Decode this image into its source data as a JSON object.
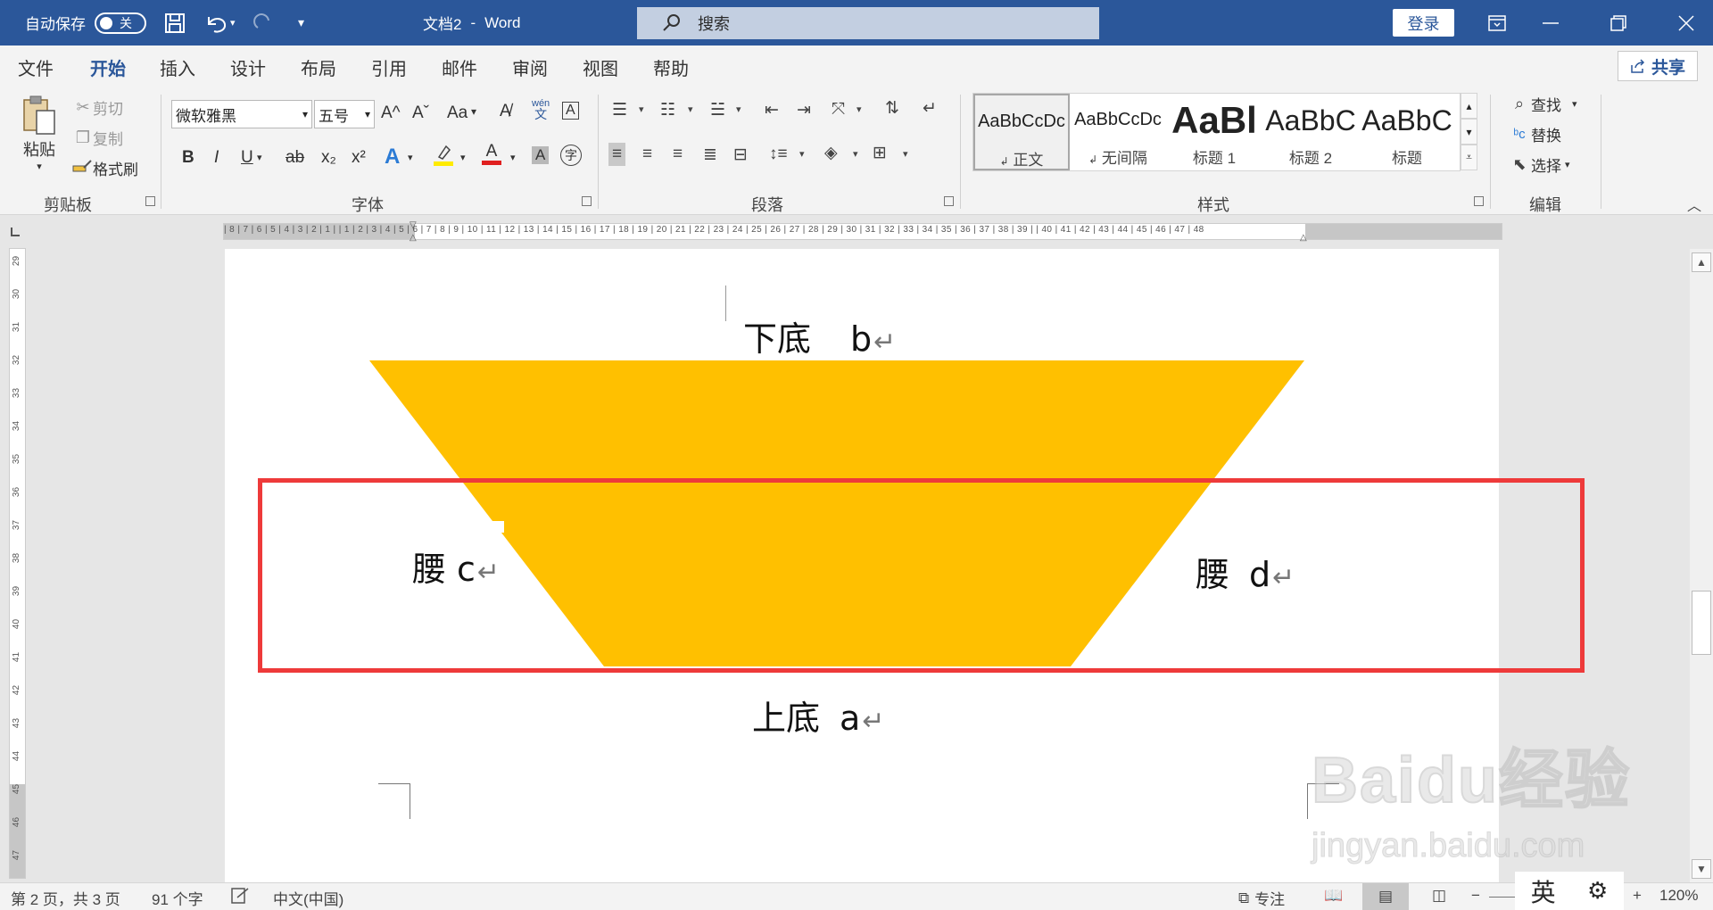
{
  "titlebar": {
    "autosave_label": "自动保存",
    "autosave_state": "关",
    "doc_title": "文档2",
    "separator": "-",
    "app_name": "Word",
    "search_placeholder": "搜索",
    "login_label": "登录"
  },
  "tabs": {
    "items": [
      "文件",
      "开始",
      "插入",
      "设计",
      "布局",
      "引用",
      "邮件",
      "审阅",
      "视图",
      "帮助"
    ],
    "active": "开始",
    "share_label": "共享"
  },
  "ribbon": {
    "clipboard": {
      "group_label": "剪贴板",
      "paste": "粘贴",
      "cut": "剪切",
      "copy": "复制",
      "format_painter": "格式刷"
    },
    "font": {
      "group_label": "字体",
      "font_name": "微软雅黑",
      "font_size": "五号",
      "grow": "A^",
      "shrink": "Aˇ",
      "change_case": "Aa",
      "phonetic_top": "wén",
      "phonetic_bottom": "文",
      "bold": "B",
      "italic": "I",
      "underline": "U",
      "strike": "ab",
      "subscript": "x₂",
      "superscript": "x²",
      "font_color_letter": "A",
      "shade_letter": "A",
      "enclose": "字",
      "colors": {
        "highlight": "#ffeb00",
        "font_color": "#e02020",
        "text_effect": "#2b7bd5"
      }
    },
    "paragraph": {
      "group_label": "段落"
    },
    "styles": {
      "group_label": "样式",
      "items": [
        {
          "preview": "AaBbCcDc",
          "name": "正文",
          "mark": "↲"
        },
        {
          "preview": "AaBbCcDc",
          "name": "无间隔",
          "mark": "↲"
        },
        {
          "preview": "AaBl",
          "name": "标题 1"
        },
        {
          "preview": "AaBbC",
          "name": "标题 2"
        },
        {
          "preview": "AaBbC",
          "name": "标题"
        }
      ]
    },
    "editing": {
      "group_label": "编辑",
      "find": "查找",
      "replace": "替换",
      "select": "选择"
    }
  },
  "ruler": {
    "horizontal_labels": "| 8 | 7 | 6 | 5 | 4 | 3 | 2 | 1 |  | 1 | 2 | 3 | 4 | 5 | 6 | 7 | 8 | 9 | 10 | 11 | 12 | 13 | 14 | 15 | 16 | 17 | 18 | 19 | 20 | 21 | 22 | 23 | 24 | 25 | 26 | 27 | 28 | 29 | 30 | 31 | 32 | 33 | 34 | 35 | 36 | 37 | 38 | 39 |  | 40 | 41 | 42 | 43 | 44 | 45 | 46 | 47 | 48",
    "vertical_labels": [
      "29",
      "30",
      "31",
      "32",
      "33",
      "34",
      "35",
      "36",
      "37",
      "38",
      "39",
      "40",
      "41",
      "42",
      "43",
      "44",
      "45",
      "46",
      "47"
    ]
  },
  "document": {
    "bottom_base_label": "下底",
    "bottom_base_var": "b",
    "left_leg_label": "腰",
    "left_leg_var": "c",
    "right_leg_label": "腰",
    "right_leg_var": "d",
    "top_base_label": "上底",
    "top_base_var": "a",
    "paragraph_mark": "↵",
    "shape_color": "#ffc000",
    "highlight_color": "#ee3a3a"
  },
  "statusbar": {
    "page_info": "第 2 页，共 3 页",
    "word_count": "91 个字",
    "language": "中文(中国)",
    "focus": "专注",
    "zoom_minus": "−",
    "zoom_plus": "+",
    "zoom_level": "120%",
    "zoom_fraction": 0.6
  },
  "ime": {
    "mode": "英"
  },
  "watermark": {
    "brand": "Baidu经验",
    "domain": "jingyan.baidu.com"
  }
}
